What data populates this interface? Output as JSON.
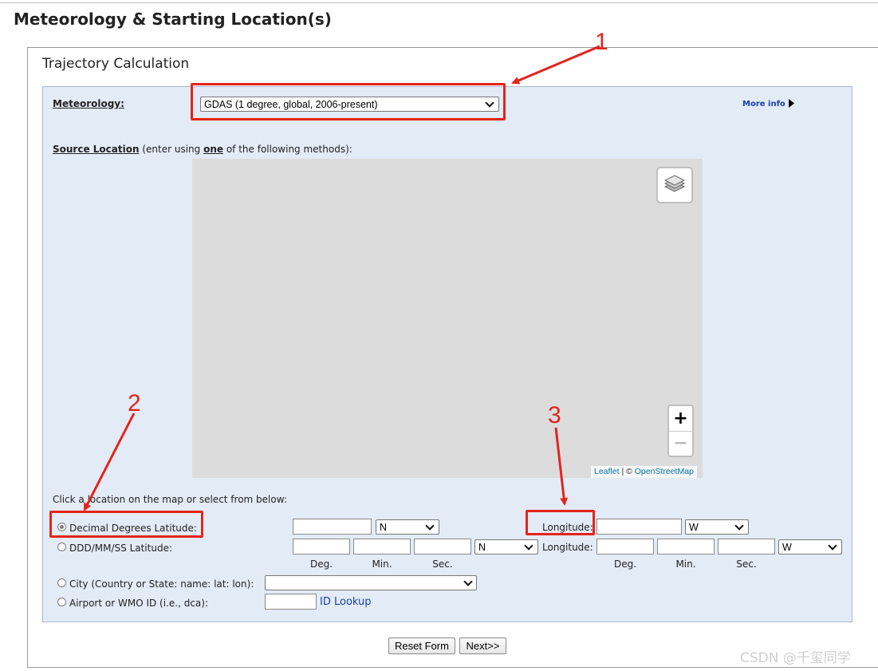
{
  "page_title": "Meteorology & Starting Location(s)",
  "section_title": "Trajectory Calculation",
  "meteorology": {
    "label": "Meteorology:",
    "selected": "GDAS (1 degree, global, 2006-present)",
    "more_info": "More info"
  },
  "source_location": {
    "label": "Source Location",
    "hint_pre": "(enter using ",
    "hint_em": "one",
    "hint_post": " of the following methods):"
  },
  "map": {
    "zoom_in": "+",
    "zoom_out": "−",
    "attribution_leaflet": "Leaflet",
    "attribution_sep": " | © ",
    "attribution_osm": "OpenStreetMap"
  },
  "click_hint": "Click a location on the map or select from below:",
  "options": {
    "decimal_label": "Decimal Degrees Latitude:",
    "dms_label": "DDD/MM/SS Latitude:",
    "city_label": "City (Country or State: name: lat: lon):",
    "airport_label": "Airport or WMO ID (i.e., dca):",
    "id_lookup": "ID Lookup",
    "longitude_label": "Longitude:",
    "lat_hemisphere": "N",
    "lon_hemisphere": "W",
    "col_deg": "Deg.",
    "col_min": "Min.",
    "col_sec": "Sec.",
    "selected_option": "decimal"
  },
  "buttons": {
    "reset": "Reset Form",
    "next": "Next>>"
  },
  "annotations": {
    "n1": "1",
    "n2": "2",
    "n3": "3",
    "color": "#e4241b"
  },
  "watermark": "CSDN @千玺同学"
}
